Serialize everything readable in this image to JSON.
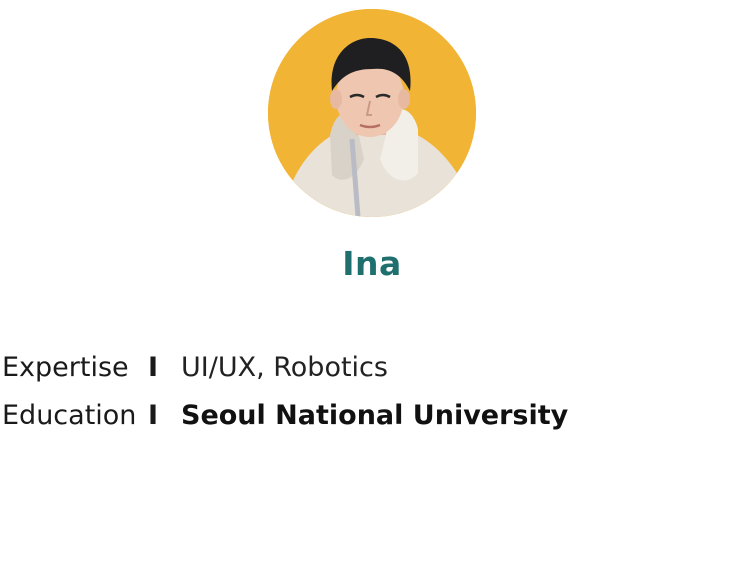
{
  "profile": {
    "name": "Ina",
    "photo_alt": "profile photo",
    "background_color": "#F1B434",
    "name_color": "#1F6F6F"
  },
  "details": [
    {
      "label": "Expertise",
      "separator": "I",
      "value": "UI/UX, Robotics"
    },
    {
      "label": "Education",
      "separator": "I",
      "value": "Seoul National University"
    }
  ]
}
